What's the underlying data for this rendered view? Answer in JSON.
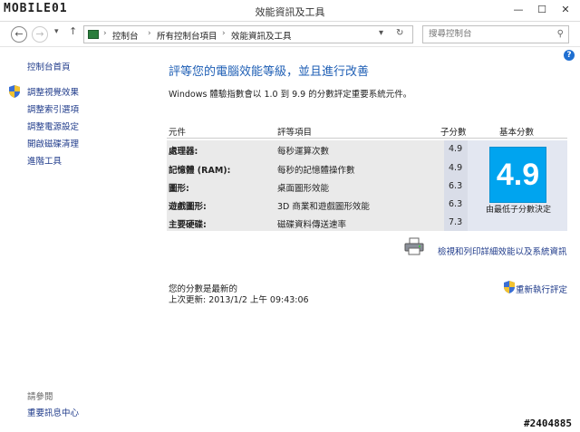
{
  "window": {
    "logo": "MOBILE01",
    "title": "效能資訊及工具",
    "minimize": "—",
    "maximize": "☐",
    "close": "✕"
  },
  "nav": {
    "back": "←",
    "forward": "→",
    "recent": "▾",
    "up": "↑",
    "breadcrumbs": [
      "控制台",
      "所有控制台項目",
      "效能資訊及工具"
    ],
    "refresh": "↻",
    "search_placeholder": "搜尋控制台"
  },
  "sidebar": {
    "items": [
      "控制台首頁",
      "調整視覺效果",
      "調整索引選項",
      "調整電源設定",
      "開啟磁碟清理",
      "進階工具"
    ],
    "see_also_heading": "請參閱",
    "see_also": [
      "重要訊息中心"
    ]
  },
  "main": {
    "title": "評等您的電腦效能等級，並且進行改善",
    "description": "Windows 體驗指數會以 1.0 到 9.9 的分數評定重要系統元件。",
    "columns": [
      "元件",
      "評等項目",
      "子分數",
      "基本分數"
    ],
    "rows": [
      {
        "component": "處理器:",
        "item": "每秒運算次數",
        "score": "4.9"
      },
      {
        "component": "記憶體 (RAM):",
        "item": "每秒的記憶體操作數",
        "score": "4.9"
      },
      {
        "component": "圖形:",
        "item": "桌面圖形效能",
        "score": "6.3"
      },
      {
        "component": "遊戲圖形:",
        "item": "3D 商業和遊戲圖形效能",
        "score": "6.3"
      },
      {
        "component": "主要硬碟:",
        "item": "磁碟資料傳送速率",
        "score": "7.3"
      }
    ],
    "base_score": "4.9",
    "base_caption": "由最低子分數決定",
    "print_link": "檢視和列印詳細效能以及系統資訊",
    "status": "您的分數是最新的",
    "last_update": "上次更新: 2013/1/2 上午 09:43:06",
    "rerun": "重新執行評定"
  },
  "watermark": "#2404885",
  "colors": {
    "accent": "#1f5fb5",
    "score_tile": "#00a4ef",
    "link": "#1e3a8a"
  }
}
